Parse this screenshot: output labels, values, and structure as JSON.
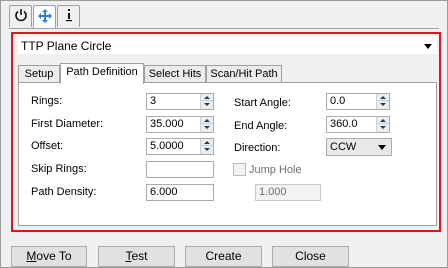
{
  "icon_tabs": [
    {
      "icon": "power-icon"
    },
    {
      "icon": "move-arrows-icon"
    },
    {
      "icon": "info-icon"
    }
  ],
  "feature_select": {
    "value": "TTP Plane Circle"
  },
  "tabs": [
    {
      "label": "Setup"
    },
    {
      "label": "Path Definition"
    },
    {
      "label": "Select Hits"
    },
    {
      "label": "Scan/Hit Path"
    }
  ],
  "path_definition": {
    "rings": {
      "label": "Rings:",
      "value": "3"
    },
    "first_diameter": {
      "label": "First Diameter:",
      "value": "35.000"
    },
    "offset": {
      "label": "Offset:",
      "value": "5.0000"
    },
    "skip_rings": {
      "label": "Skip Rings:",
      "value": ""
    },
    "path_density": {
      "label": "Path Density:",
      "value": "6.000"
    },
    "start_angle": {
      "label": "Start Angle:",
      "value": "0.0"
    },
    "end_angle": {
      "label": "End Angle:",
      "value": "360.0"
    },
    "direction": {
      "label": "Direction:",
      "value": "CCW"
    },
    "jump_hole": {
      "label": "Jump Hole",
      "checked": false,
      "value": "1.000"
    }
  },
  "buttons": {
    "move_to": {
      "mnemonic": "M",
      "rest": "ove To"
    },
    "test": {
      "mnemonic": "T",
      "rest": "est"
    },
    "create": "Create",
    "close": "Close"
  },
  "colors": {
    "highlight_frame": "#e0141e",
    "panel": "#ffffff",
    "window": "#f0f0f0"
  }
}
